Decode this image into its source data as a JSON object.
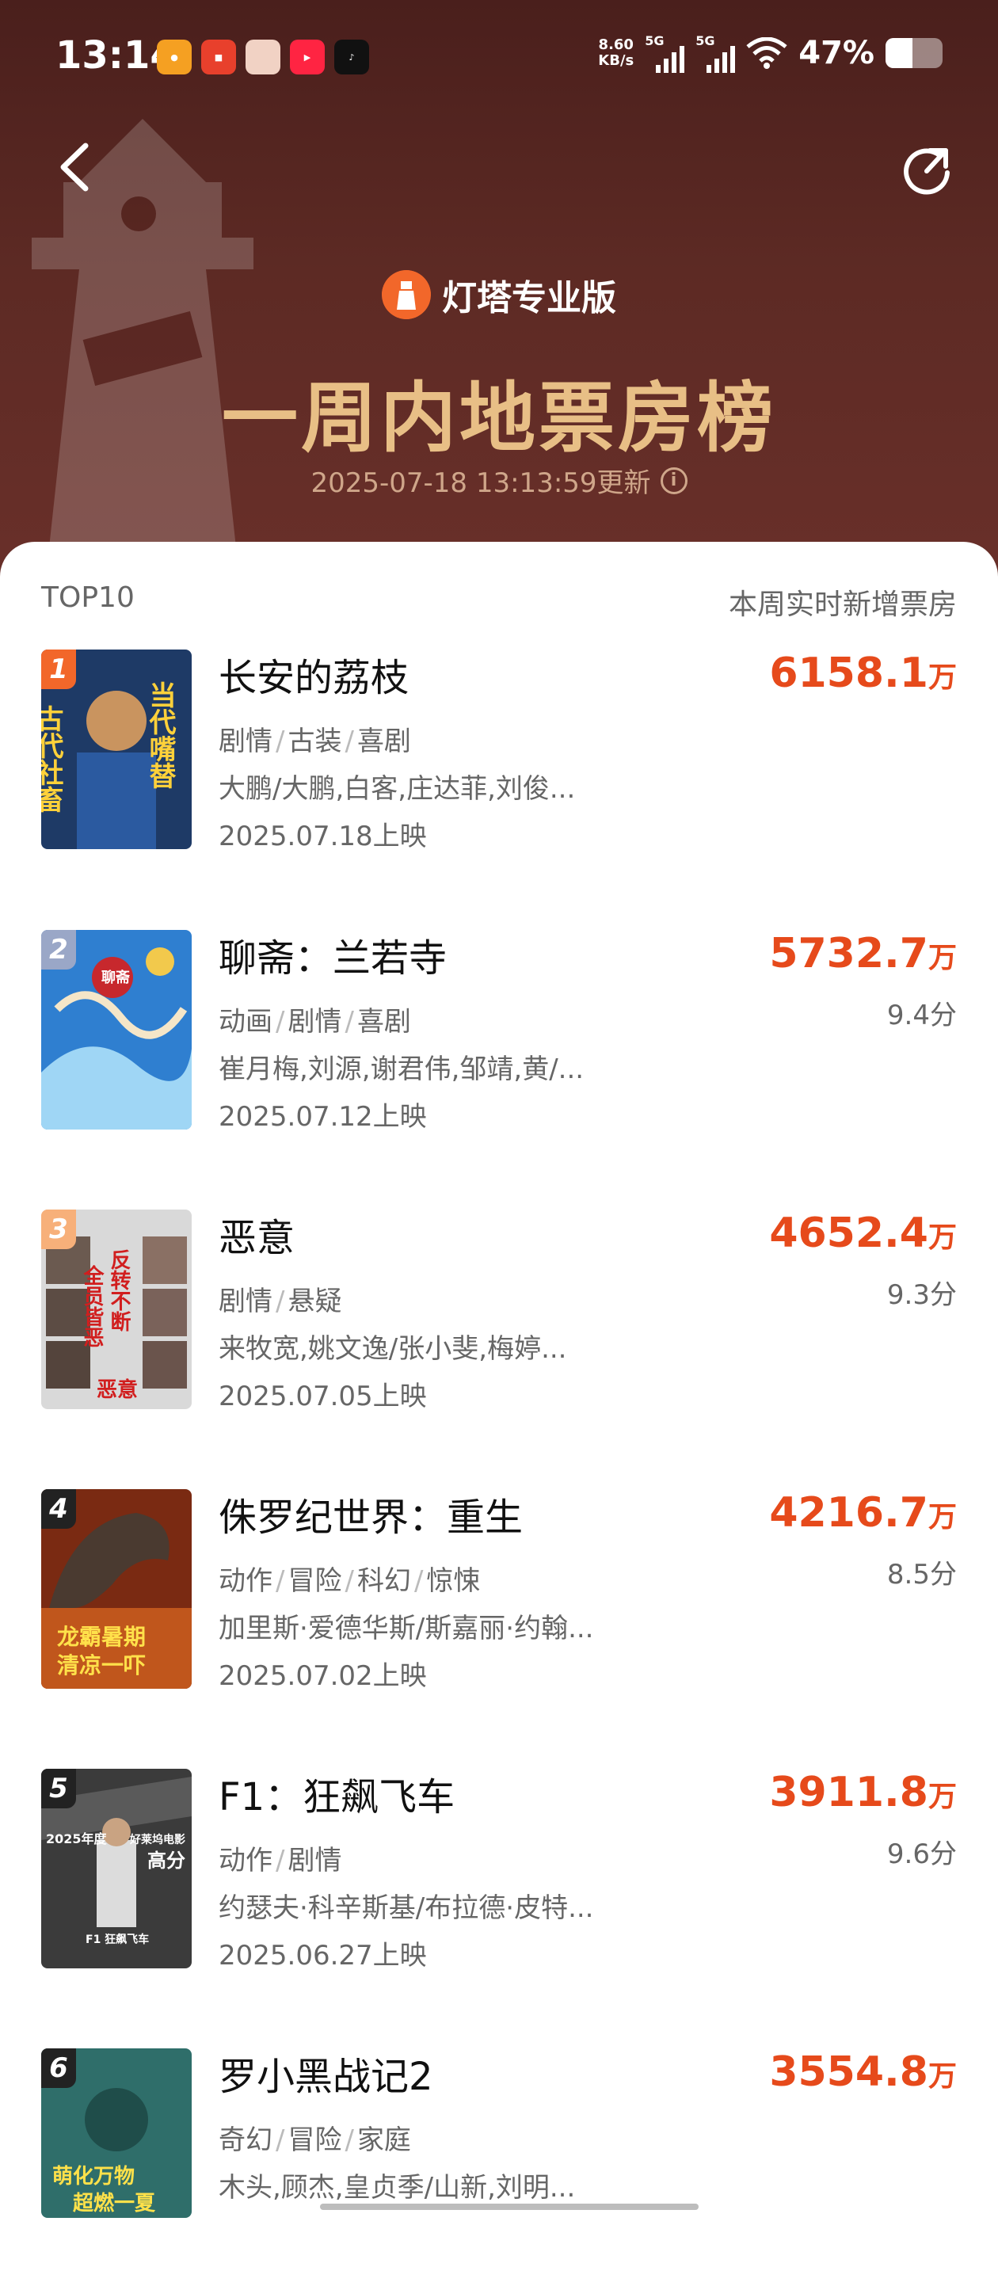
{
  "status_bar": {
    "time": "13:14",
    "net_speed_value": "8.60",
    "net_speed_unit": "KB/s",
    "signal1": "5G",
    "signal2": "5G",
    "battery": "47%"
  },
  "header": {
    "brand": "灯塔专业版",
    "title": "一周内地票房榜",
    "updated": "2025-07-18 13:13:59更新"
  },
  "list": {
    "left_label": "TOP10",
    "right_label": "本周实时新增票房",
    "unit": "万",
    "items": [
      {
        "rank": "1",
        "title": "长安的荔枝",
        "genres": [
          "剧情",
          "古装",
          "喜剧"
        ],
        "cast": "大鹏/大鹏,白客,庄达菲,刘俊...",
        "date": "2025.07.18上映",
        "gross": "6158.1",
        "score": ""
      },
      {
        "rank": "2",
        "title": "聊斋：兰若寺",
        "genres": [
          "动画",
          "剧情",
          "喜剧"
        ],
        "cast": "崔月梅,刘源,谢君伟,邹靖,黄/...",
        "date": "2025.07.12上映",
        "gross": "5732.7",
        "score": "9.4分"
      },
      {
        "rank": "3",
        "title": "恶意",
        "genres": [
          "剧情",
          "悬疑"
        ],
        "cast": "来牧宽,姚文逸/张小斐,梅婷...",
        "date": "2025.07.05上映",
        "gross": "4652.4",
        "score": "9.3分"
      },
      {
        "rank": "4",
        "title": "侏罗纪世界：重生",
        "genres": [
          "动作",
          "冒险",
          "科幻",
          "惊悚"
        ],
        "cast": "加里斯·爱德华斯/斯嘉丽·约翰...",
        "date": "2025.07.02上映",
        "gross": "4216.7",
        "score": "8.5分"
      },
      {
        "rank": "5",
        "title": "F1：狂飙飞车",
        "genres": [
          "动作",
          "剧情"
        ],
        "cast": "约瑟夫·科辛斯基/布拉德·皮特...",
        "date": "2025.06.27上映",
        "gross": "3911.8",
        "score": "9.6分"
      },
      {
        "rank": "6",
        "title": "罗小黑战记2",
        "genres": [
          "奇幻",
          "冒险",
          "家庭"
        ],
        "cast": "木头,顾杰,皇贞季/山新,刘明...",
        "date": "",
        "gross": "3554.8",
        "score": ""
      }
    ]
  },
  "posters": [
    {
      "text_a": "古代社畜",
      "text_b": "当代嘴替"
    },
    {
      "text_a": "聊斋"
    },
    {
      "text_a": "全员皆恶",
      "text_b": "反转不断",
      "text_c": "恶意"
    },
    {
      "text_a": "龙霸暑期",
      "text_b": "清凉一吓"
    },
    {
      "text_a": "2025年度",
      "text_b": "好莱坞电影",
      "text_c": "高分",
      "text_d": "F1 狂飙飞车"
    },
    {
      "text_a": "萌化万物",
      "text_b": "超燃一夏"
    }
  ],
  "colors": {
    "header_bg": "#5d2a24",
    "title_gold": "#e8bf86",
    "gross_red": "#e64a1b",
    "rank1": "#f2672a",
    "rank2": "#9aa7c7",
    "rank3": "#f7b07a",
    "rank_other": "#222222"
  }
}
